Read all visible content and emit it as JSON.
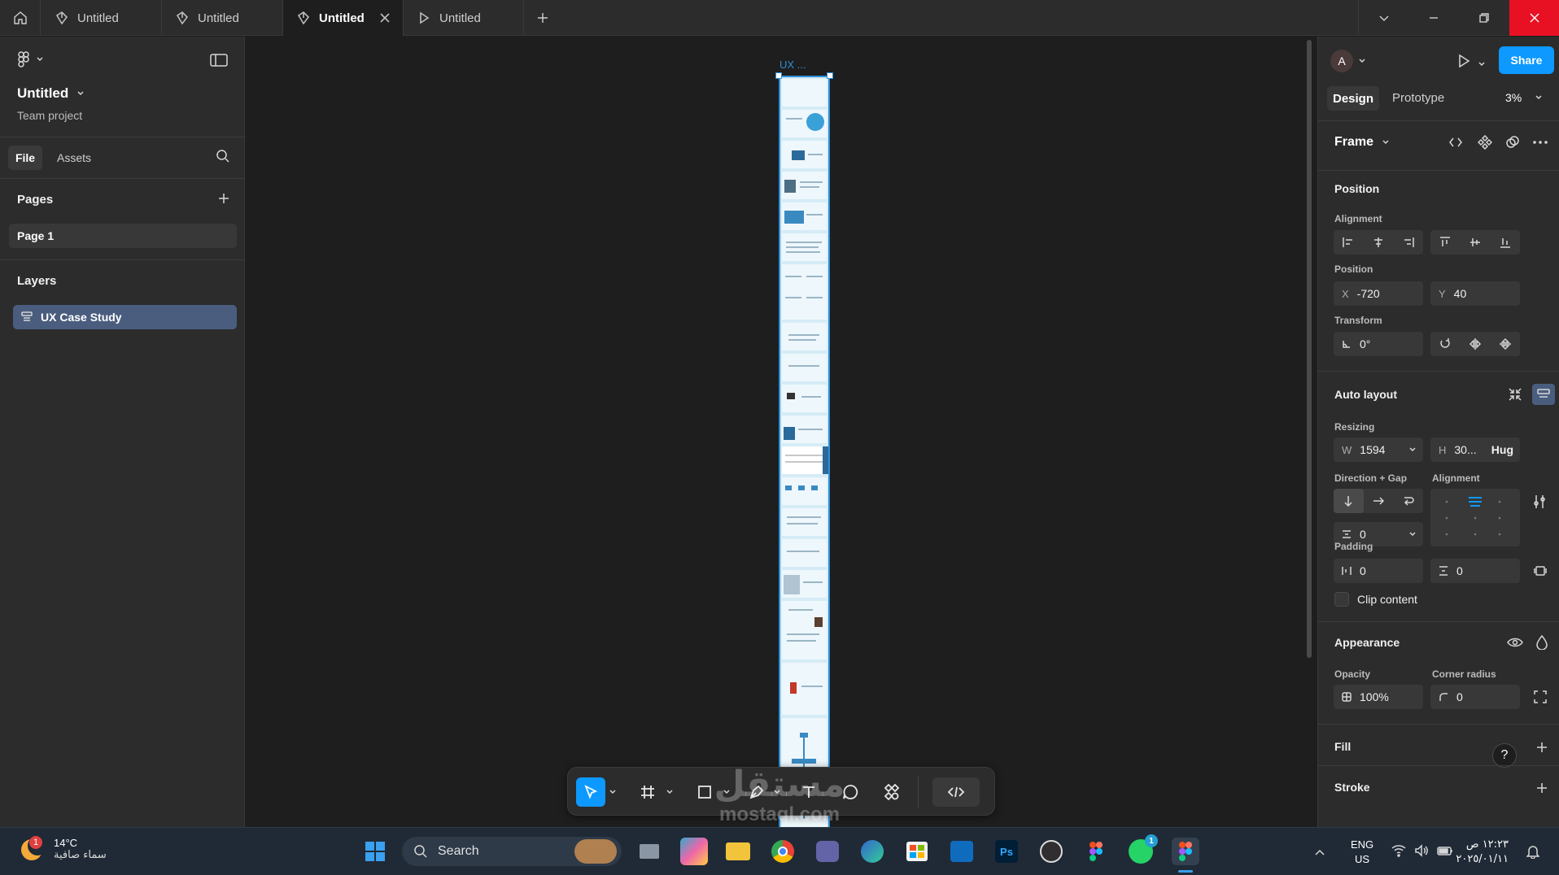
{
  "tabs": [
    {
      "label": "Untitled",
      "icon": "figma-file-icon",
      "active": false
    },
    {
      "label": "Untitled",
      "icon": "figma-file-icon",
      "active": false
    },
    {
      "label": "Untitled",
      "icon": "figma-file-icon",
      "active": true
    },
    {
      "label": "Untitled",
      "icon": "prototype-play-icon",
      "active": false
    }
  ],
  "left": {
    "file_name": "Untitled",
    "project": "Team project",
    "tab_file": "File",
    "tab_assets": "Assets",
    "pages_title": "Pages",
    "page_item": "Page 1",
    "layers_title": "Layers",
    "layer_item": "UX Case Study"
  },
  "canvas": {
    "frame_label": "UX ..."
  },
  "right": {
    "avatar_letter": "A",
    "share": "Share",
    "tab_design": "Design",
    "tab_prototype": "Prototype",
    "zoom": "3%",
    "frame_type": "Frame",
    "position_title": "Position",
    "alignment_label": "Alignment",
    "position_label": "Position",
    "x_prefix": "X",
    "x_value": "-720",
    "y_prefix": "Y",
    "y_value": "40",
    "transform_label": "Transform",
    "rotation": "0°",
    "auto_layout_title": "Auto layout",
    "resizing_label": "Resizing",
    "w_prefix": "W",
    "w_value": "1594",
    "h_prefix": "H",
    "h_value": "30...",
    "h_mode": "Hug",
    "direction_gap_label": "Direction + Gap",
    "alignment2_label": "Alignment",
    "gap_value": "0",
    "padding_label": "Padding",
    "padding_h": "0",
    "padding_v": "0",
    "clip_content": "Clip content",
    "appearance_title": "Appearance",
    "opacity_label": "Opacity",
    "opacity_value": "100%",
    "corner_label": "Corner radius",
    "corner_value": "0",
    "fill_title": "Fill",
    "stroke_title": "Stroke",
    "help": "?"
  },
  "watermark": {
    "arabic": "مستقل",
    "domain": "mostaql.com"
  },
  "taskbar": {
    "weather_temp": "14°C",
    "weather_desc": "سماء صافية",
    "weather_badge": "1",
    "search": "Search",
    "lang_top": "ENG",
    "lang_bottom": "US",
    "time": "١٢:٢٣ ص",
    "date": "٢٠٢٥/٠١/١١",
    "whatsapp_badge": "1"
  },
  "colors": {
    "accent": "#0d99ff",
    "selection": "#2e8fd8",
    "close_red": "#e81123",
    "layer_selected": "#4a5d7e"
  }
}
